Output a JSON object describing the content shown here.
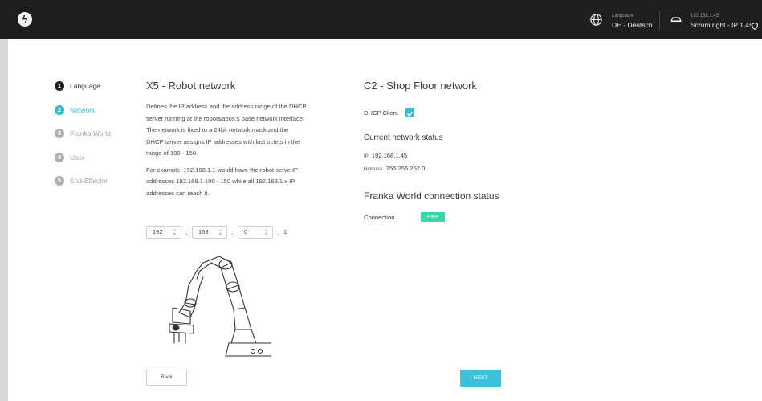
{
  "topbar": {
    "language_label": "Language",
    "language_value": "DE - Deutsch",
    "robot_ip": "192.168.1.45",
    "robot_name": "Scrum right - IP 1.45"
  },
  "steps": [
    {
      "number": "1",
      "label": "Language",
      "state": "done"
    },
    {
      "number": "2",
      "label": "Network",
      "state": "active"
    },
    {
      "number": "3",
      "label": "Franka World",
      "state": "pending"
    },
    {
      "number": "4",
      "label": "User",
      "state": "pending"
    },
    {
      "number": "5",
      "label": "End-Effector",
      "state": "pending"
    }
  ],
  "x5": {
    "title": "X5 - Robot network",
    "description_1": "Defines the IP address and the address range of the DHCP server running at the robot&apos;s base network interface. The network is fixed to a 24bit network mask and the DHCP server assigns IP addresses with last octets in the range of 100 - 150.",
    "description_2": "For example, 192.168.1.1 would have the robot serve IP addresses 192.168.1.100 - 150 while all 192.168.1.x IP addresses can reach it.",
    "octet_1": "192",
    "octet_2": "168",
    "octet_3": "0",
    "octet_4": "1",
    "separator": "."
  },
  "c2": {
    "title": "C2 - Shop Floor network",
    "dhcp_label": "DHCP Client",
    "dhcp_checked": true,
    "status_title": "Current network status",
    "ip_label": "IP",
    "ip_value": "192.168.1.45",
    "netmask_label": "Netmask",
    "netmask_value": "255.255.252.0"
  },
  "franka_world": {
    "title": "Franka World connection status",
    "connection_label": "Connection",
    "connection_status": "online"
  },
  "buttons": {
    "back": "Back",
    "next": "NEXT"
  },
  "colors": {
    "accent": "#40b8d4",
    "online": "#38d6a8",
    "topbar": "#1e1e1e"
  }
}
